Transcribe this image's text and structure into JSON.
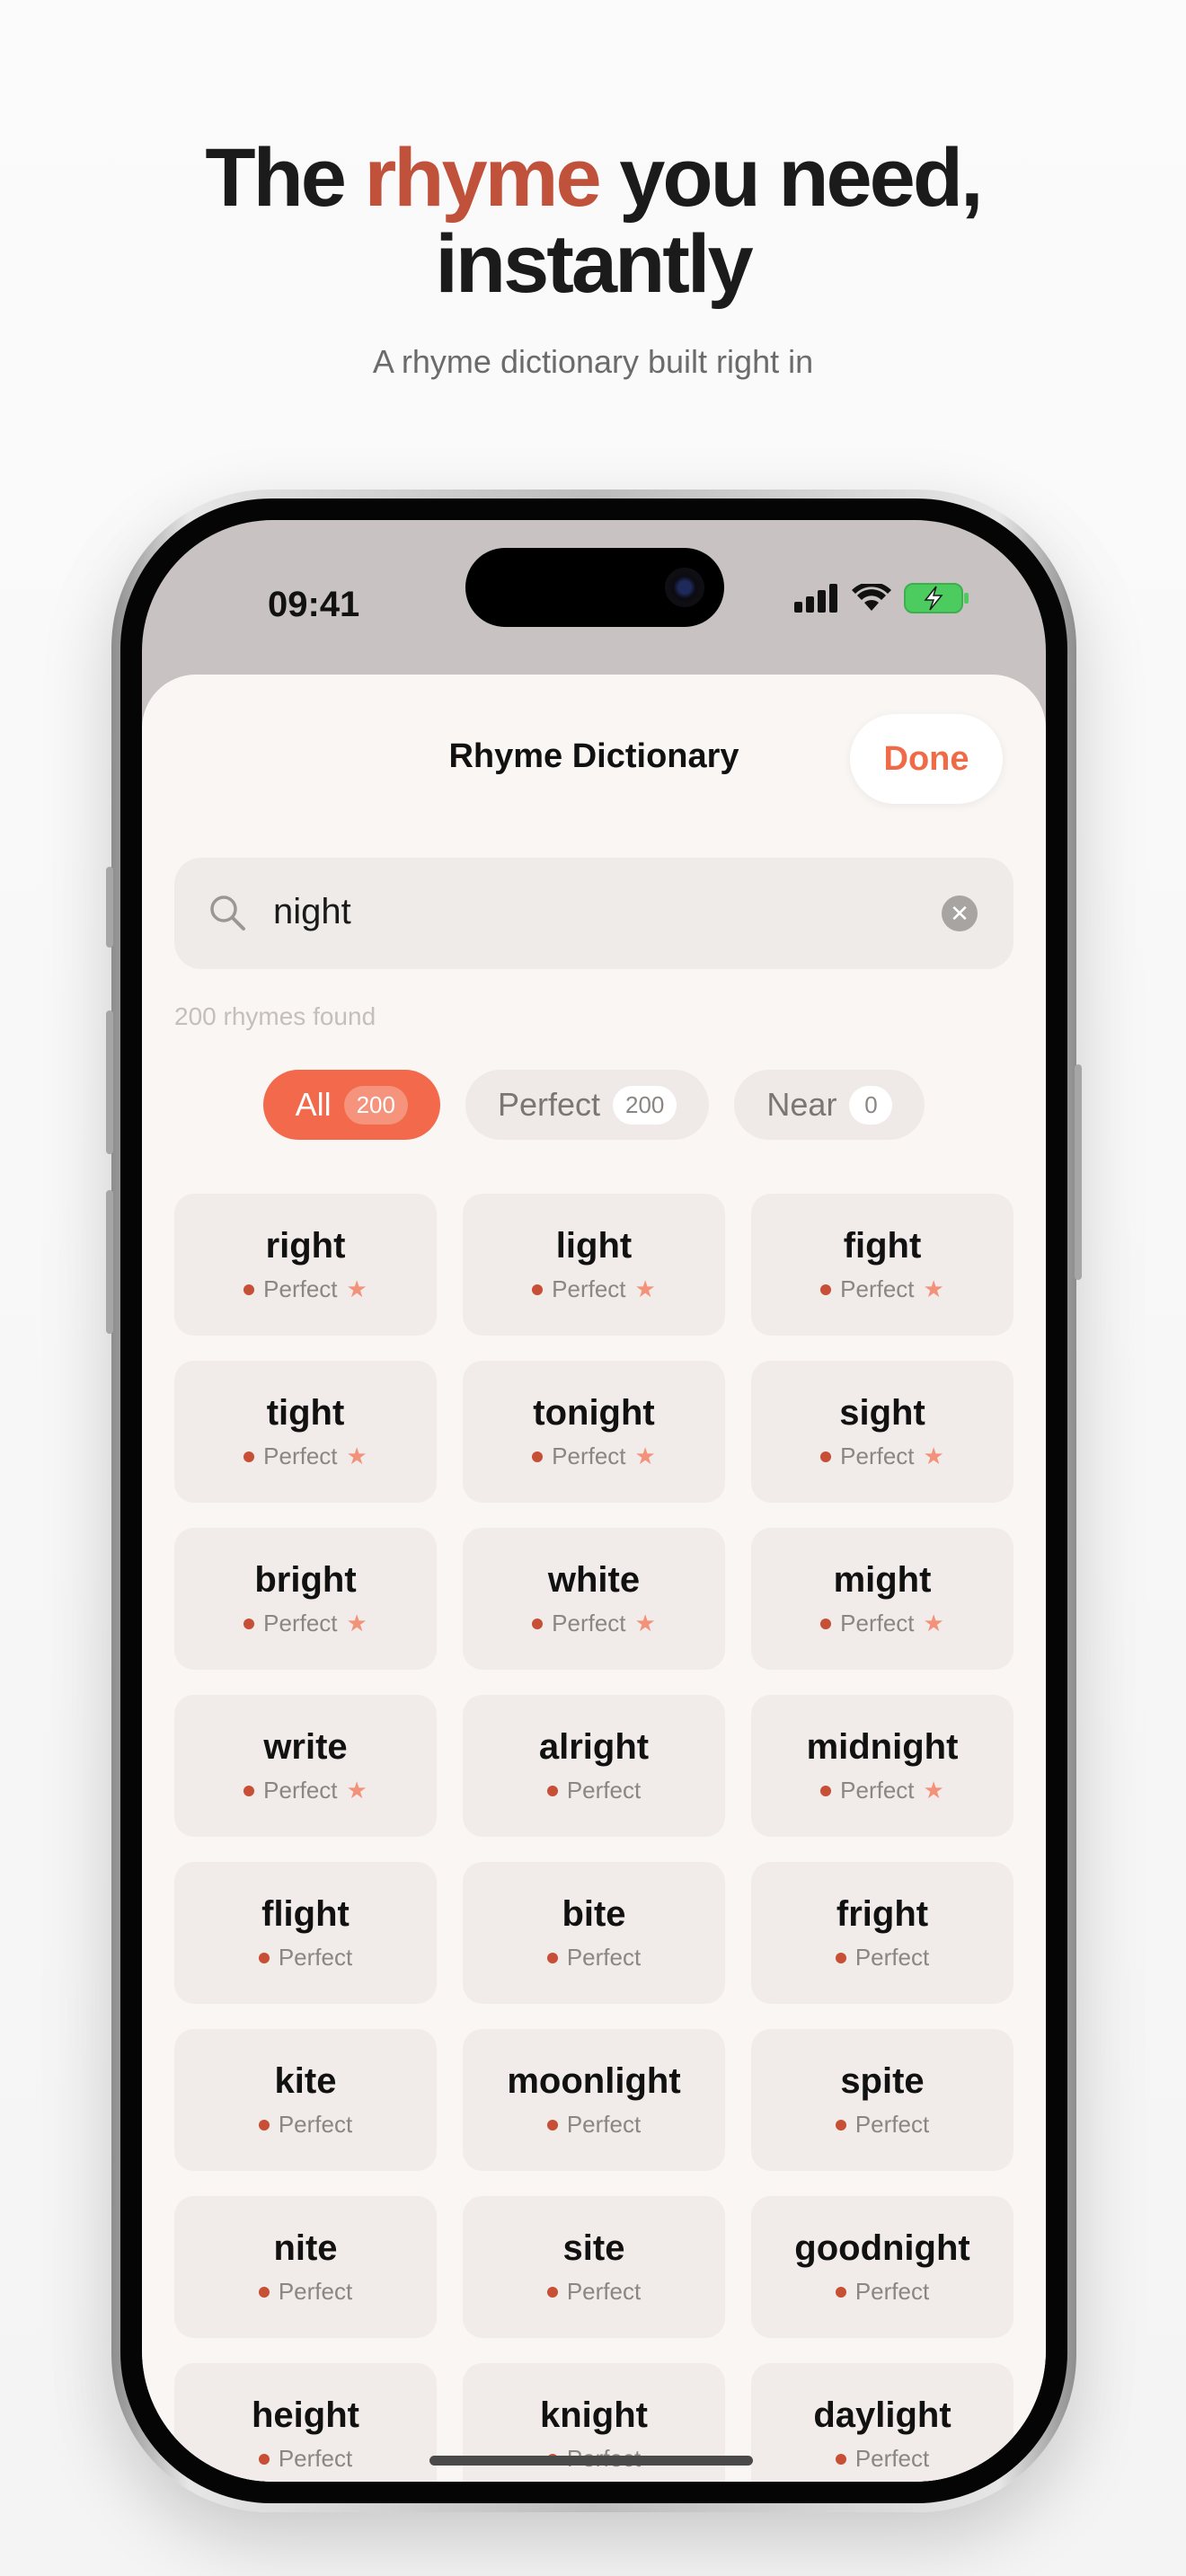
{
  "headline": {
    "part1": "The ",
    "accent": "rhyme",
    "part2": " you need,",
    "line2": "instantly"
  },
  "subtitle": "A rhyme dictionary built right in",
  "status_bar": {
    "time": "09:41"
  },
  "sheet": {
    "title": "Rhyme Dictionary",
    "done_label": "Done"
  },
  "search": {
    "value": "night"
  },
  "results_count": "200 rhymes found",
  "filters": [
    {
      "label": "All",
      "count": "200"
    },
    {
      "label": "Perfect",
      "count": "200"
    },
    {
      "label": "Near",
      "count": "0"
    }
  ],
  "rhymes": [
    {
      "word": "right",
      "type": "Perfect",
      "starred": true
    },
    {
      "word": "light",
      "type": "Perfect",
      "starred": true
    },
    {
      "word": "fight",
      "type": "Perfect",
      "starred": true
    },
    {
      "word": "tight",
      "type": "Perfect",
      "starred": true
    },
    {
      "word": "tonight",
      "type": "Perfect",
      "starred": true
    },
    {
      "word": "sight",
      "type": "Perfect",
      "starred": true
    },
    {
      "word": "bright",
      "type": "Perfect",
      "starred": true
    },
    {
      "word": "white",
      "type": "Perfect",
      "starred": true
    },
    {
      "word": "might",
      "type": "Perfect",
      "starred": true
    },
    {
      "word": "write",
      "type": "Perfect",
      "starred": true
    },
    {
      "word": "alright",
      "type": "Perfect",
      "starred": false
    },
    {
      "word": "midnight",
      "type": "Perfect",
      "starred": true
    },
    {
      "word": "flight",
      "type": "Perfect",
      "starred": false
    },
    {
      "word": "bite",
      "type": "Perfect",
      "starred": false
    },
    {
      "word": "fright",
      "type": "Perfect",
      "starred": false
    },
    {
      "word": "kite",
      "type": "Perfect",
      "starred": false
    },
    {
      "word": "moonlight",
      "type": "Perfect",
      "starred": false
    },
    {
      "word": "spite",
      "type": "Perfect",
      "starred": false
    },
    {
      "word": "nite",
      "type": "Perfect",
      "starred": false
    },
    {
      "word": "site",
      "type": "Perfect",
      "starred": false
    },
    {
      "word": "goodnight",
      "type": "Perfect",
      "starred": false
    },
    {
      "word": "height",
      "type": "Perfect",
      "starred": false
    },
    {
      "word": "knight",
      "type": "Perfect",
      "starred": false
    },
    {
      "word": "daylight",
      "type": "Perfect",
      "starred": false
    }
  ],
  "colors": {
    "accent": "#f26a4b",
    "headline_accent": "#c0513b",
    "perfect_dot": "#c64f36",
    "star": "#f3927a"
  },
  "icons": {
    "search": "search-icon",
    "clear": "clear-icon",
    "star": "star-icon"
  }
}
